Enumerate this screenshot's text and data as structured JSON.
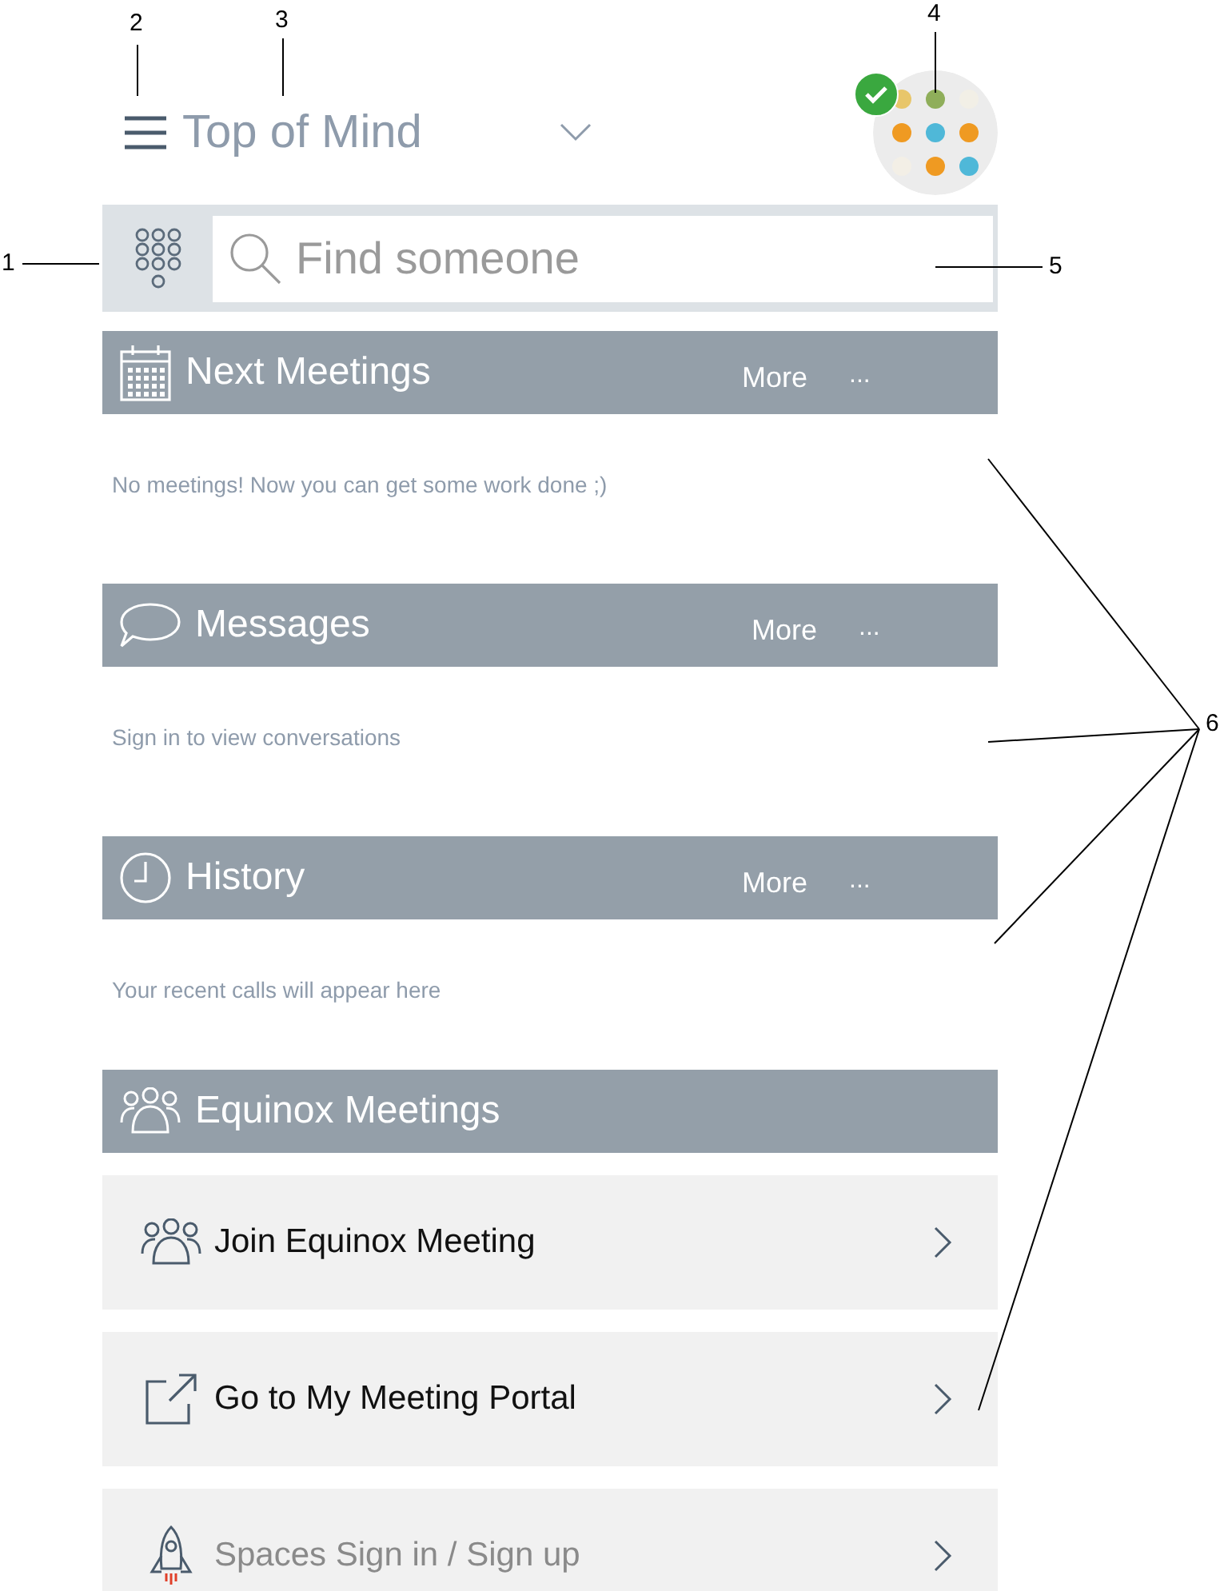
{
  "header": {
    "title": "Top of Mind",
    "online": true
  },
  "search": {
    "placeholder": "Find someone"
  },
  "sections": [
    {
      "kind": "calendar",
      "title": "Next Meetings",
      "more": "More",
      "ellipsis": "...",
      "empty_text": "No meetings! Now you can get some work done ;)"
    },
    {
      "kind": "chat",
      "title": "Messages",
      "more": "More",
      "ellipsis": "...",
      "empty_text": "Sign in to view conversations"
    },
    {
      "kind": "clock",
      "title": "History",
      "more": "More",
      "ellipsis": "...",
      "empty_text": "Your recent calls will appear here"
    }
  ],
  "equinox": {
    "title": "Equinox Meetings",
    "items": [
      {
        "kind": "people",
        "label": "Join Equinox Meeting",
        "disabled": false
      },
      {
        "kind": "external",
        "label": "Go to My Meeting Portal",
        "disabled": false
      },
      {
        "kind": "rocket",
        "label": "Spaces Sign in / Sign up",
        "disabled": true
      }
    ]
  },
  "callouts": [
    {
      "number": "1"
    },
    {
      "number": "2"
    },
    {
      "number": "3"
    },
    {
      "number": "4"
    },
    {
      "number": "5"
    },
    {
      "number": "6"
    }
  ]
}
